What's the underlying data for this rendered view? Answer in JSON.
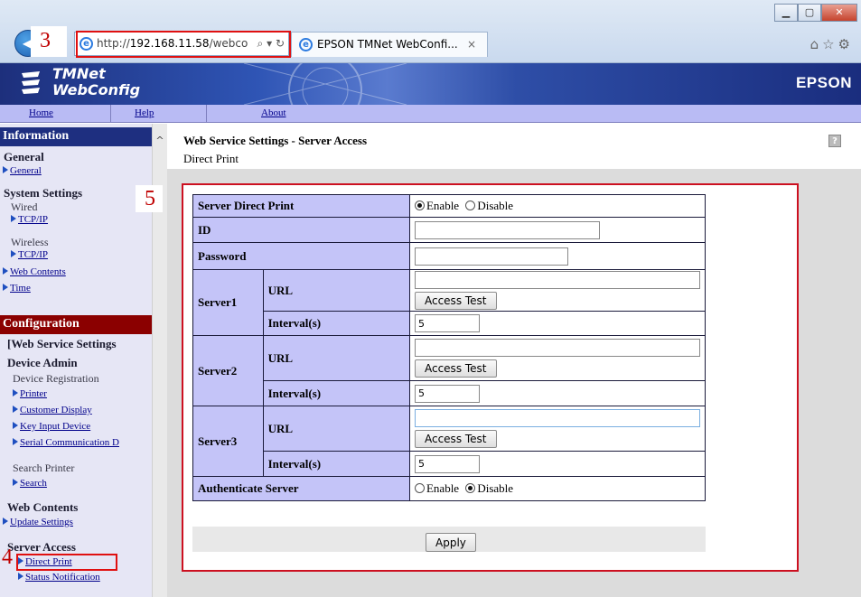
{
  "browser": {
    "address": {
      "prefix": "http://",
      "host": "192.168.11.58",
      "path": "/webco"
    },
    "tab_title": "EPSON TMNet WebConfi...",
    "tab_close": "×"
  },
  "header": {
    "logo_line1": "TMNet",
    "logo_line2": "WebConfig",
    "brand": "EPSON"
  },
  "topnav": {
    "home": "Home",
    "help": "Help",
    "about": "About"
  },
  "sidebar": {
    "information": "Information",
    "general_title": "General",
    "general_link": "General",
    "system_title": "System Settings",
    "wired": "Wired",
    "wired_tcpip": "TCP/IP",
    "wireless": "Wireless",
    "wireless_tcpip": "TCP/IP",
    "web_contents_link": "Web Contents",
    "time_link": "Time",
    "configuration": "Configuration",
    "selected": "[Web Service Settings",
    "device_admin": "Device Admin",
    "device_registration": "Device Registration",
    "printer": "Printer",
    "customer_display": "Customer Display",
    "key_input": "Key Input Device",
    "serial_comm": "Serial Communication D",
    "search_printer": "Search Printer",
    "search": "Search",
    "web_contents_title": "Web Contents",
    "update_settings": "Update Settings",
    "server_access_title": "Server Access",
    "direct_print": "Direct Print",
    "status_notification": "Status Notification"
  },
  "main": {
    "title": "Web Service Settings - Server Access",
    "subtitle": "Direct Print",
    "help": "?"
  },
  "form": {
    "server_direct_print": "Server Direct Print",
    "enable": "Enable",
    "disable": "Disable",
    "id": "ID",
    "password": "Password",
    "server1": "Server1",
    "server2": "Server2",
    "server3": "Server3",
    "url": "URL",
    "interval": "Interval(s)",
    "access_test": "Access Test",
    "interval1": "5",
    "interval2": "5",
    "interval3": "5",
    "authenticate_server": "Authenticate Server",
    "apply": "Apply"
  },
  "annotations": {
    "three": "3",
    "four": "4",
    "five": "5"
  },
  "colors": {
    "banner": "#1d2f7c",
    "nav": "#b9bbf4",
    "label_cell": "#c4c4f8",
    "info_head": "#1e2f80",
    "config_head": "#8b0000",
    "highlight": "#e01010"
  }
}
